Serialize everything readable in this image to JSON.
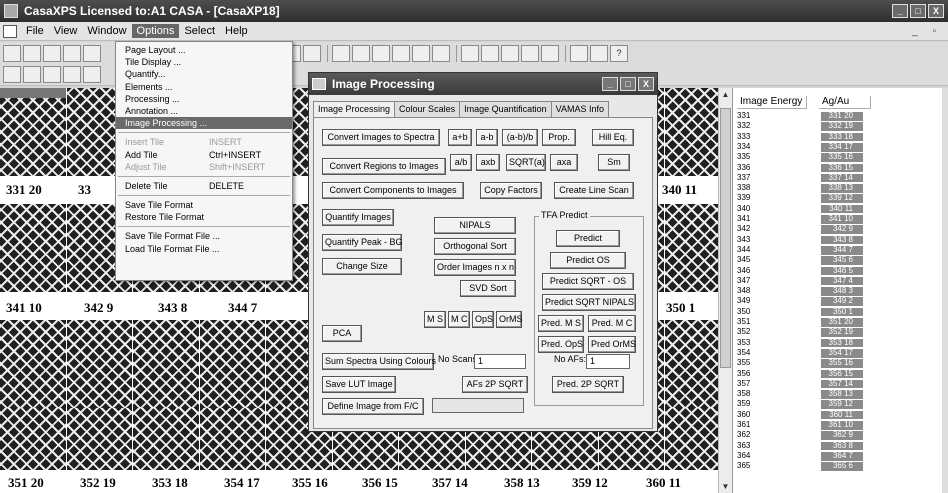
{
  "app": {
    "title": "CasaXPS Licensed to:A1 CASA - [CasaXP18]",
    "controls": [
      "_",
      "□",
      "X"
    ]
  },
  "menubar": {
    "items": [
      "File",
      "View",
      "Window",
      "Options",
      "Select",
      "Help"
    ],
    "active": "Options"
  },
  "options_menu": {
    "items": [
      {
        "label": "Page Layout ..."
      },
      {
        "label": "Tile Display ..."
      },
      {
        "label": "Quantify..."
      },
      {
        "label": "Elements ..."
      },
      {
        "label": "Processing ..."
      },
      {
        "label": "Annotation ..."
      },
      {
        "label": "Image Processing ...",
        "highlighted": true
      },
      {
        "sep": true
      },
      {
        "label": "Insert Tile",
        "shortcut": "INSERT",
        "disabled": true
      },
      {
        "label": "Add Tile",
        "shortcut": "Ctrl+INSERT"
      },
      {
        "label": "Adjust Tile",
        "shortcut": "Shift+INSERT",
        "disabled": true
      },
      {
        "sep": true
      },
      {
        "label": "Delete Tile",
        "shortcut": "DELETE"
      },
      {
        "sep": true
      },
      {
        "label": "Save Tile Format"
      },
      {
        "label": "Restore Tile Format"
      },
      {
        "sep": true
      },
      {
        "label": "Save Tile Format File ..."
      },
      {
        "label": "Load Tile Format File ..."
      }
    ]
  },
  "tile_labels": {
    "row1": [
      "331 20",
      "33",
      "340 11"
    ],
    "row2": [
      "341 10",
      "342 9",
      "343 8",
      "344 7",
      "350 1"
    ],
    "row3": [
      "351 20",
      "352 19",
      "353 18",
      "354 17",
      "355 16",
      "356 15",
      "357 14",
      "358 13",
      "359 12",
      "360 11"
    ]
  },
  "dialog": {
    "title": "Image Processing",
    "tabs": [
      "Image Processing",
      "Colour Scales",
      "Image Quantification",
      "VAMAS Info"
    ],
    "buttons": {
      "convert_images": "Convert Images to Spectra",
      "a_plus_b": "a+b",
      "a_minus_b": "a-b",
      "a_minus_b_over_b": "(a-b)/b",
      "prop": "Prop.",
      "hill_eq": "Hill Eq.",
      "convert_regions": "Convert Regions to Images",
      "a_over_b": "a/b",
      "a_times_b": "axb",
      "sqrt_a": "SQRT(a)",
      "a_times_a": "axa",
      "sm": "Sm",
      "convert_components": "Convert Components to Images",
      "copy_factors": "Copy Factors",
      "create_line_scan": "Create Line Scan",
      "quantify_images": "Quantify Images",
      "nipals": "NIPALS",
      "quantify_peak_bg": "Quantify Peak - BG",
      "orthogonal_sort": "Orthogonal Sort",
      "change_size": "Change Size",
      "order_images": "Order Images n x n",
      "svd_sort": "SVD Sort",
      "ms": "M S",
      "mc": "M C",
      "ops": "OpS",
      "ormS": "OrMS",
      "pca": "PCA",
      "sum_spectra": "Sum Spectra Using Colours",
      "save_lut": "Save LUT Image",
      "afs_2p_sqrt": "AFs 2P SQRT",
      "define_image": "Define Image from F/C",
      "predict": "Predict",
      "predict_os": "Predict OS",
      "predict_sqrt_os": "Predict SQRT - OS",
      "predict_sqrt_nipals": "Predict SQRT NIPALS",
      "pred_ms": "Pred. M S",
      "pred_mc": "Pred. M C",
      "pred_ops": "Pred. OpS",
      "pred_orms": "Pred OrMS",
      "pred_2p_sqrt": "Pred. 2P SQRT"
    },
    "tfa_group_label": "TFA Predict",
    "no_scans_label": "No Scans:",
    "no_scans_value": "1",
    "no_afs_label": "No AFs:",
    "no_afs_value": "1",
    "define_value": ""
  },
  "table": {
    "headers": [
      "Image Energy",
      "Ag/Au"
    ],
    "rows": [
      [
        "331",
        "331 20"
      ],
      [
        "332",
        "332 19"
      ],
      [
        "333",
        "333 18"
      ],
      [
        "334",
        "334 17"
      ],
      [
        "335",
        "335 16"
      ],
      [
        "336",
        "336 15"
      ],
      [
        "337",
        "337 14"
      ],
      [
        "338",
        "338 13"
      ],
      [
        "339",
        "339 12"
      ],
      [
        "340",
        "340 11"
      ],
      [
        "341",
        "341 10"
      ],
      [
        "342",
        "342 9"
      ],
      [
        "343",
        "343 8"
      ],
      [
        "344",
        "344 7"
      ],
      [
        "345",
        "345 6"
      ],
      [
        "346",
        "346 5"
      ],
      [
        "347",
        "347 4"
      ],
      [
        "348",
        "348 3"
      ],
      [
        "349",
        "349 2"
      ],
      [
        "350",
        "350 1"
      ],
      [
        "351",
        "351 20"
      ],
      [
        "352",
        "352 19"
      ],
      [
        "353",
        "353 18"
      ],
      [
        "354",
        "354 17"
      ],
      [
        "355",
        "355 16"
      ],
      [
        "356",
        "356 15"
      ],
      [
        "357",
        "357 14"
      ],
      [
        "358",
        "358 13"
      ],
      [
        "359",
        "359 12"
      ],
      [
        "360",
        "360 11"
      ],
      [
        "361",
        "361 10"
      ],
      [
        "362",
        "362 9"
      ],
      [
        "363",
        "363 8"
      ],
      [
        "364",
        "364 7"
      ],
      [
        "365",
        "365 6"
      ]
    ]
  }
}
